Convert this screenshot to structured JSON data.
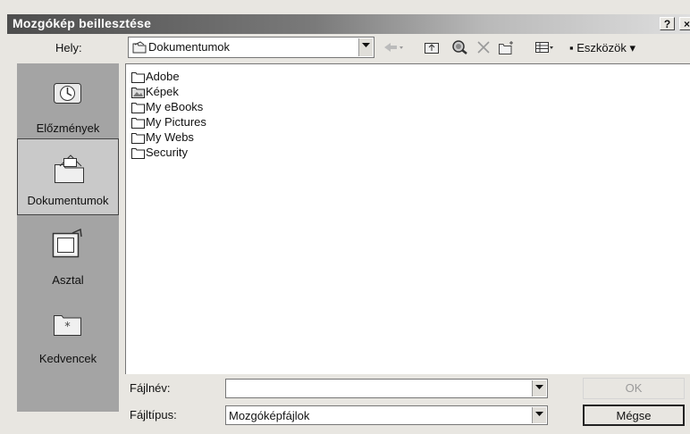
{
  "window": {
    "title": "Mozgókép beillesztése",
    "help_label": "?",
    "close_label": "×"
  },
  "location": {
    "label": "Hely:",
    "value": "Dokumentumok"
  },
  "toolbar": {
    "icons": [
      "back-icon",
      "up-folder-icon",
      "search-web-icon",
      "delete-icon",
      "new-folder-icon",
      "views-icon"
    ],
    "tools_label": "▪ Eszközök ▾"
  },
  "places": [
    {
      "label": "Előzmények",
      "icon": "history-icon"
    },
    {
      "label": "Dokumentumok",
      "icon": "documents-icon",
      "selected": true
    },
    {
      "label": "Asztal",
      "icon": "desktop-icon"
    },
    {
      "label": "Kedvencek",
      "icon": "favorites-icon"
    }
  ],
  "files": [
    {
      "name": "Adobe",
      "icon": "folder-icon"
    },
    {
      "name": "Képek",
      "icon": "pictures-folder-icon"
    },
    {
      "name": "My eBooks",
      "icon": "folder-icon"
    },
    {
      "name": "My Pictures",
      "icon": "folder-icon"
    },
    {
      "name": "My Webs",
      "icon": "folder-icon"
    },
    {
      "name": "Security",
      "icon": "folder-icon"
    }
  ],
  "filename": {
    "label": "Fájlnév:",
    "value": ""
  },
  "filetype": {
    "label": "Fájltípus:",
    "value": "Mozgóképfájlok"
  },
  "buttons": {
    "ok": "OK",
    "cancel": "Mégse"
  }
}
